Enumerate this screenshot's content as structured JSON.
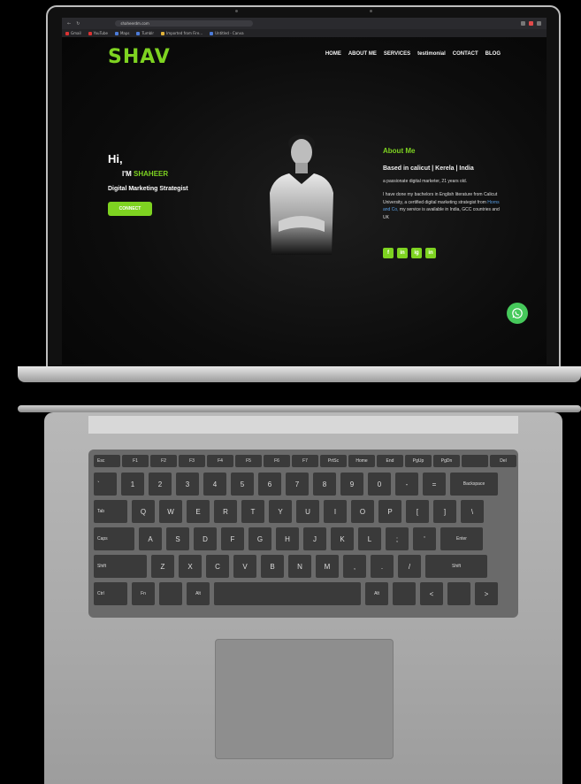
{
  "browser": {
    "url": "shaheerdm.com",
    "bookmarks": [
      "Gmail",
      "YouTube",
      "Maps",
      "Tumblr",
      "Imported from Fire...",
      "Untitled - Canva"
    ]
  },
  "site": {
    "logo": "SHAV",
    "nav": [
      "HOME",
      "ABOUT ME",
      "SERVICES",
      "testimonial",
      "CONTACT",
      "BLOG"
    ]
  },
  "hero": {
    "greeting": "Hi,",
    "im_prefix": "I'M",
    "name": "SHAHEER",
    "role": "Digital Marketing Strategist",
    "cta": "CONNECT"
  },
  "about": {
    "heading": "About Me",
    "location": "Based in calicut | Kerela | India",
    "tagline": "a passionate digital marketer, 21 years old.",
    "bio_1": "I have done my bachelors in English literature from Calicut University, a certified digital marketing strategist from",
    "bio_link": "Horns and Co,",
    "bio_2": "my service is available in India, GCC countries and UK",
    "socials": [
      "f",
      "in",
      "ig",
      "in"
    ]
  },
  "colors": {
    "accent": "#7ed321",
    "whatsapp": "#46c95b",
    "background": "#0c0c0c"
  },
  "icons": {
    "whatsapp": "whatsapp-icon"
  },
  "keyboard": {
    "row0": [
      "Esc",
      "F1",
      "F2",
      "F3",
      "F4",
      "F5",
      "F6",
      "F7",
      "PrtSc",
      "Home",
      "End",
      "PgUp",
      "PgDn",
      "",
      "Del"
    ],
    "row1": [
      "`",
      "1",
      "2",
      "3",
      "4",
      "5",
      "6",
      "7",
      "8",
      "9",
      "0",
      "-",
      "=",
      "Backspace"
    ],
    "row2": [
      "Tab",
      "Q",
      "W",
      "E",
      "R",
      "T",
      "Y",
      "U",
      "I",
      "O",
      "P",
      "[",
      "]",
      "\\"
    ],
    "row3": [
      "Caps",
      "A",
      "S",
      "D",
      "F",
      "G",
      "H",
      "J",
      "K",
      "L",
      ";",
      "'",
      "Enter"
    ],
    "row4": [
      "Shift",
      "Z",
      "X",
      "C",
      "V",
      "B",
      "N",
      "M",
      ",",
      ".",
      "/",
      "Shift"
    ],
    "row5": [
      "Ctrl",
      "Fn",
      "",
      "Alt",
      "",
      "Alt",
      "",
      "<",
      "",
      ">"
    ]
  }
}
